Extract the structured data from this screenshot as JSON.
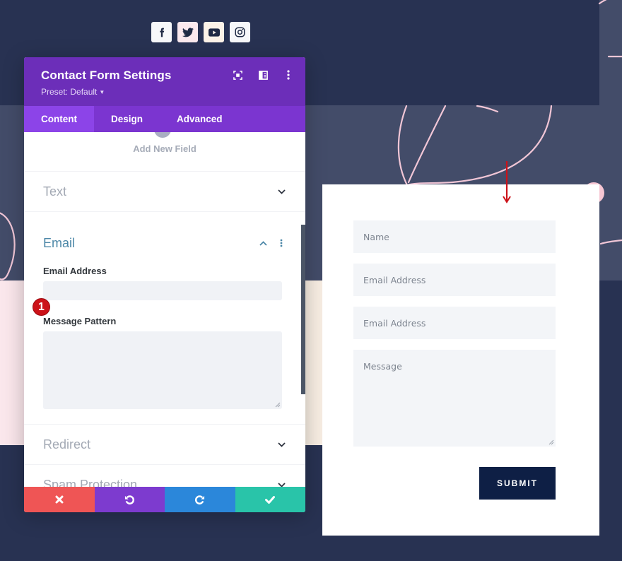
{
  "social": {
    "icons": [
      "facebook-icon",
      "twitter-icon",
      "youtube-icon",
      "instagram-icon"
    ]
  },
  "panel": {
    "title": "Contact Form Settings",
    "preset": "Preset: Default",
    "header_icons": [
      "focus-icon",
      "sidebar-layout-icon",
      "more-options-icon"
    ],
    "tabs": [
      {
        "label": "Content",
        "active": true
      },
      {
        "label": "Design",
        "active": false
      },
      {
        "label": "Advanced",
        "active": false
      }
    ],
    "add_field_label": "Add New Field",
    "toggles": {
      "text": "Text",
      "email": "Email",
      "redirect": "Redirect",
      "spam": "Spam Protection"
    },
    "email_section": {
      "email_address_label": "Email Address",
      "email_address_value": "",
      "message_pattern_label": "Message Pattern",
      "message_pattern_value": ""
    },
    "badge_number": "1",
    "footer_buttons": [
      "cancel",
      "undo",
      "redo",
      "save"
    ],
    "colors": {
      "header": "#6c2eb9",
      "tabs": "#7b35d0",
      "active_tab": "#8c44e8",
      "cancel": "#ef5555",
      "undo": "#7d3bcf",
      "redo": "#2b87da",
      "save": "#29c4a9",
      "badge": "#cc1219"
    }
  },
  "form_preview": {
    "fields": [
      "Name",
      "Email Address",
      "Email Address"
    ],
    "message_placeholder": "Message",
    "submit_label": "SUBMIT",
    "submit_color": "#0e1f45"
  }
}
